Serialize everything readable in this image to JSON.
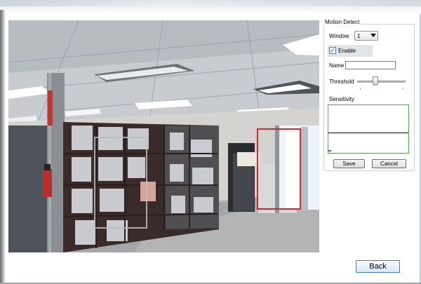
{
  "motion_detect": {
    "title": "Motion Detect",
    "window_label": "Window",
    "window_value": "1",
    "enable_label": "Enable",
    "enable_checked": true,
    "name_label": "Name",
    "name_value": "",
    "threshold_label": "Threshold",
    "threshold_level": 0.38,
    "sensitivity_label": "Sensitivity",
    "sensitivity_level": 0.42,
    "save_label": "Save",
    "cancel_label": "Cancel"
  },
  "back_label": "Back",
  "colors": {
    "detection_box": "#d4282e",
    "graph_border": "#5aa659",
    "back_border": "#3c7fb1"
  }
}
